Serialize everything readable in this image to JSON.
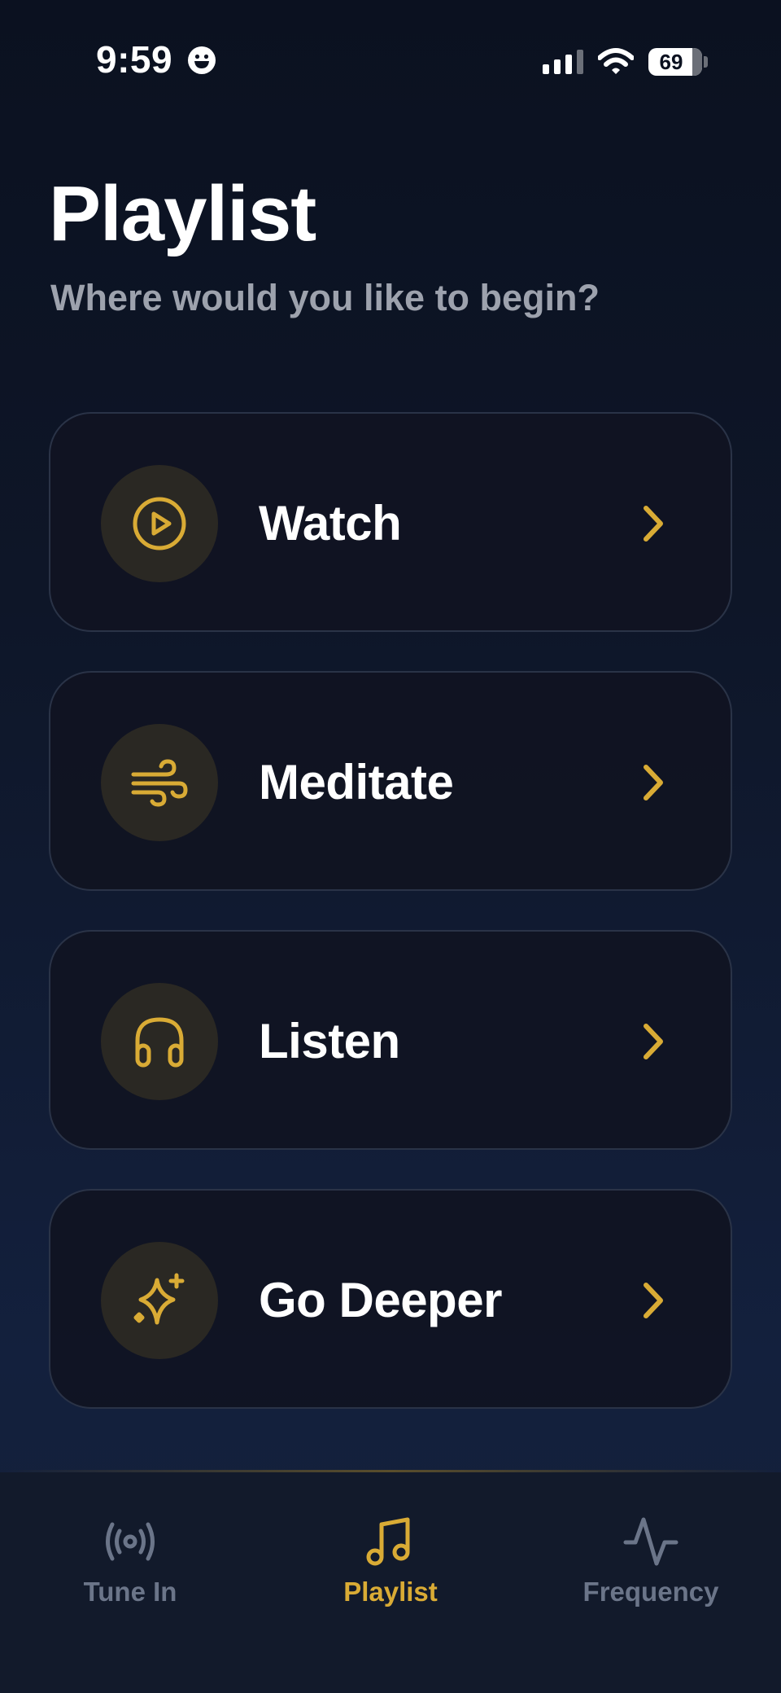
{
  "status_bar": {
    "time": "9:59",
    "battery": "69"
  },
  "header": {
    "title": "Playlist",
    "subtitle": "Where would you like to begin?"
  },
  "cards": [
    {
      "label": "Watch",
      "icon": "play-circle-icon"
    },
    {
      "label": "Meditate",
      "icon": "wind-icon"
    },
    {
      "label": "Listen",
      "icon": "headphones-icon"
    },
    {
      "label": "Go Deeper",
      "icon": "sparkles-icon"
    }
  ],
  "tab_bar": {
    "tabs": [
      {
        "label": "Tune In",
        "icon": "broadcast-icon",
        "active": false
      },
      {
        "label": "Playlist",
        "icon": "music-note-icon",
        "active": true
      },
      {
        "label": "Frequency",
        "icon": "activity-wave-icon",
        "active": false
      }
    ]
  },
  "colors": {
    "accent": "#d9ab35",
    "background": "#0e1628",
    "card": "#101422",
    "muted": "#6b7589"
  }
}
